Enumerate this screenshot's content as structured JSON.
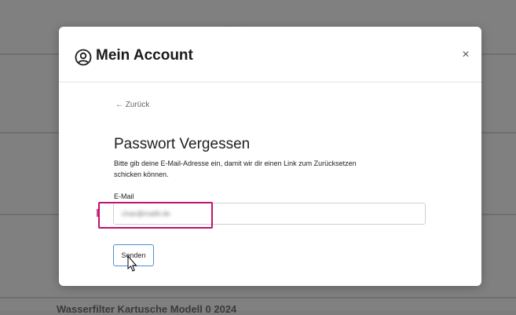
{
  "background": {
    "top_text": "········",
    "bottom_text": "Wasserfilter Kartusche Modell 0 2024"
  },
  "modal": {
    "title": "Mein Account",
    "close_label": "×",
    "back_label": "← Zurück",
    "heading": "Passwort Vergessen",
    "description": "Bitte gib deine E-Mail-Adresse ein, damit wir dir einen Link zum Zurücksetzen schicken können.",
    "email_label": "E-Mail",
    "email_value": "chas@mailit.de",
    "submit_label": "Senden"
  },
  "colors": {
    "highlight": "#c0136d",
    "button_border": "#4d8fd6"
  },
  "icons": {
    "account": "user-circle-icon",
    "close": "close-icon",
    "cursor": "mouse-pointer-icon"
  }
}
